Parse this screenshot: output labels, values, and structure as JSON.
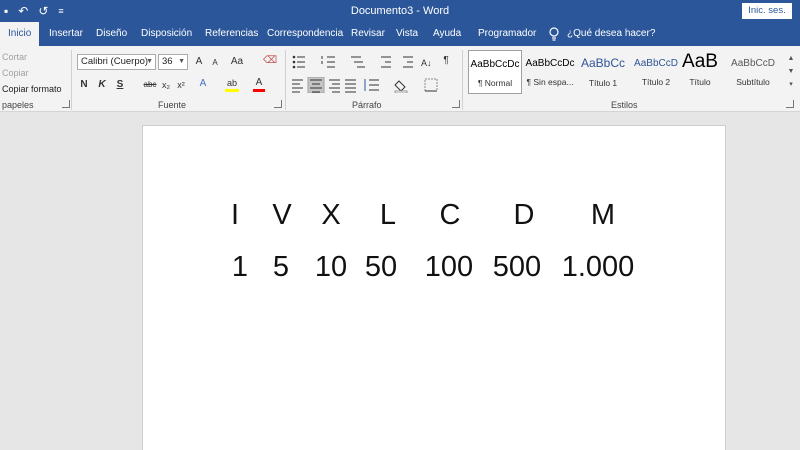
{
  "titlebar": {
    "document_title": "Documento3 - Word",
    "signin_label": "Inic. ses."
  },
  "tabs": [
    {
      "label": "Inicio"
    },
    {
      "label": "Insertar"
    },
    {
      "label": "Diseño"
    },
    {
      "label": "Disposición"
    },
    {
      "label": "Referencias"
    },
    {
      "label": "Correspondencia"
    },
    {
      "label": "Revisar"
    },
    {
      "label": "Vista"
    },
    {
      "label": "Ayuda"
    },
    {
      "label": "Programador"
    },
    {
      "label": "¿Qué desea hacer?"
    }
  ],
  "clipboard": {
    "cut": "Cortar",
    "copy": "Copiar",
    "format_painter": "Copiar formato",
    "group_label": "papeles"
  },
  "font": {
    "name": "Calibri (Cuerpo)",
    "size": "36",
    "group_label": "Fuente",
    "bold": "N",
    "italic": "K",
    "underline": "S",
    "strikethrough": "abc",
    "subscript": "x₂",
    "superscript": "x²",
    "change_case": "Aa",
    "grow": "A",
    "shrink": "A",
    "text_effects": "A",
    "highlight": "ab",
    "font_color": "A"
  },
  "paragraph": {
    "group_label": "Párrafo",
    "show_marks": "¶"
  },
  "styles": {
    "group_label": "Estilos",
    "items": [
      {
        "preview": "AaBbCcDc",
        "name": "¶ Normal"
      },
      {
        "preview": "AaBbCcDc",
        "name": "¶ Sin espa..."
      },
      {
        "preview": "AaBbCc",
        "name": "Título 1"
      },
      {
        "preview": "AaBbCcD",
        "name": "Título 2"
      },
      {
        "preview": "AaB",
        "name": "Título"
      },
      {
        "preview": "AaBbCcD",
        "name": "Subtítulo"
      }
    ]
  },
  "document": {
    "roman_row": [
      "I",
      "V",
      "X",
      "L",
      "C",
      "D",
      "M"
    ],
    "value_row": [
      "1",
      "5",
      "10",
      "50",
      "100",
      "500",
      "1.000"
    ]
  },
  "colors": {
    "accent": "#2b579a",
    "highlight": "#ffff00",
    "font_red": "#ff0000"
  }
}
